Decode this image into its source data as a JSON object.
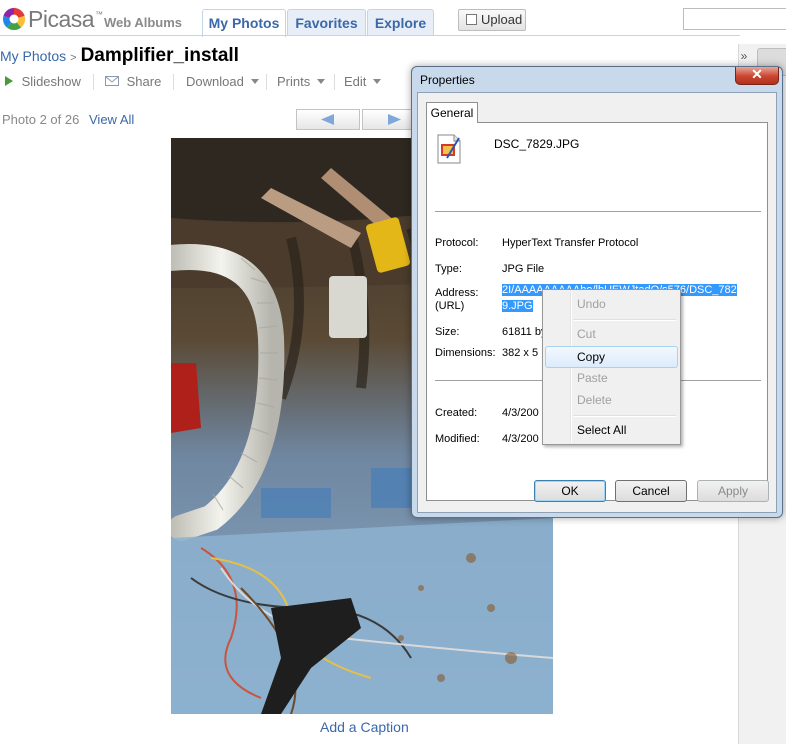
{
  "header": {
    "logo_word": "Picasa",
    "logo_sub": "Web Albums",
    "tabs": [
      {
        "label": "My Photos",
        "active": true
      },
      {
        "label": "Favorites",
        "active": false
      },
      {
        "label": "Explore",
        "active": false
      }
    ],
    "upload_label": "Upload",
    "search_value": ""
  },
  "breadcrumb": {
    "root": "My Photos",
    "separator": ">",
    "album": "Damplifier_install"
  },
  "toolbar": {
    "slideshow": "Slideshow",
    "share": "Share",
    "download": "Download",
    "prints": "Prints",
    "edit": "Edit"
  },
  "photo_nav": {
    "count_text": "Photo 2 of 26",
    "view_all": "View All"
  },
  "caption_link": "Add a Caption",
  "side_strip": {
    "collapse_glyph": "»"
  },
  "dialog": {
    "title": "Properties",
    "close_glyph": "✕",
    "tab": "General",
    "filename": "DSC_7829.JPG",
    "fields": {
      "protocol_label": "Protocol:",
      "protocol_value": "HyperText Transfer Protocol",
      "type_label": "Type:",
      "type_value": "JPG File",
      "address_label": "Address:",
      "address_label2": "(URL)",
      "address_value_line1": "2I/AAAAAAAAAbo/lbUEWJtadQ/s576/DSC_782",
      "address_value_line2": "9.JPG",
      "size_label": "Size:",
      "size_value": "61811 by",
      "dimensions_label": "Dimensions:",
      "dimensions_value": "382 x 5",
      "created_label": "Created:",
      "created_value": "4/3/200",
      "modified_label": "Modified:",
      "modified_value": "4/3/200"
    },
    "buttons": {
      "ok": "OK",
      "cancel": "Cancel",
      "apply": "Apply"
    }
  },
  "context_menu": {
    "items": [
      {
        "label": "Undo",
        "enabled": false
      },
      {
        "label": "Cut",
        "enabled": false
      },
      {
        "label": "Copy",
        "enabled": true,
        "highlighted": true
      },
      {
        "label": "Paste",
        "enabled": false
      },
      {
        "label": "Delete",
        "enabled": false
      },
      {
        "label": "Select All",
        "enabled": true
      }
    ]
  },
  "colors": {
    "link_blue": "#3a68a8",
    "selection_blue": "#3399ff",
    "dialog_frame": "#c8d9ec"
  }
}
